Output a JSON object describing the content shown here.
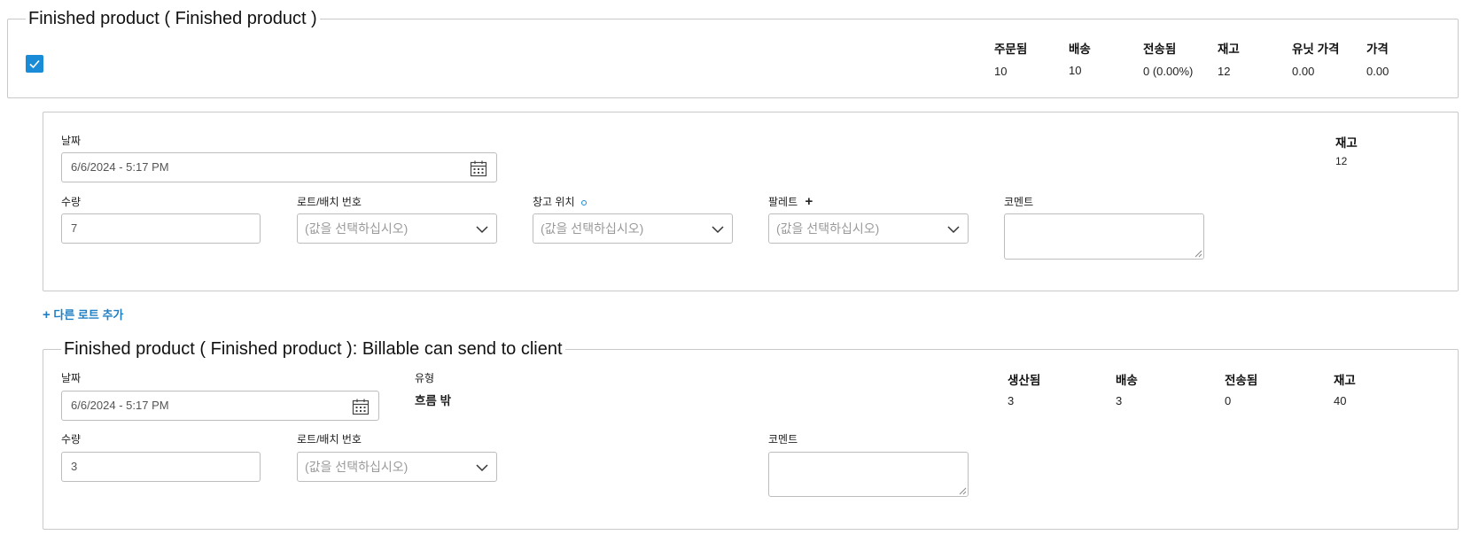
{
  "product_section": {
    "title": "Finished product ( Finished product )",
    "checked": true,
    "columns": [
      {
        "label": "주문됨",
        "value": "10"
      },
      {
        "label": "배송",
        "value": "10"
      },
      {
        "label": "전송됨",
        "value": "0 (0.00%)"
      },
      {
        "label": "재고",
        "value": "12"
      },
      {
        "label": "유닛 가격",
        "value": "0.00"
      },
      {
        "label": "가격",
        "value": "0.00"
      }
    ]
  },
  "lot_entry": {
    "date_label": "날짜",
    "date_value": "6/6/2024 - 5:17 PM",
    "stock_label": "재고",
    "stock_value": "12",
    "qty_label": "수량",
    "qty_value": "7",
    "lot_label": "로트/배치 번호",
    "lot_placeholder": "(값을 선택하십시오)",
    "warehouse_label": "창고 위치",
    "warehouse_placeholder": "(값을 선택하십시오)",
    "pallet_label": "팔레트",
    "pallet_placeholder": "(값을 선택하십시오)",
    "comment_label": "코멘트"
  },
  "add_lot_link": "다른 로트 추가",
  "billable_section": {
    "title": "Finished product ( Finished product ): Billable can send to client",
    "date_label": "날짜",
    "date_value": "6/6/2024 - 5:17 PM",
    "type_label": "유형",
    "type_value": "흐름 밖",
    "columns": [
      {
        "label": "생산됨",
        "value": "3"
      },
      {
        "label": "배송",
        "value": "3"
      },
      {
        "label": "전송됨",
        "value": "0"
      },
      {
        "label": "재고",
        "value": "40"
      }
    ],
    "qty_label": "수량",
    "qty_value": "3",
    "lot_label": "로트/배치 번호",
    "lot_placeholder": "(값을 선택하십시오)",
    "comment_label": "코멘트"
  },
  "colors": {
    "accent": "#1a8bd6",
    "link": "#1f7fc4",
    "border": "#c9c9c9"
  }
}
